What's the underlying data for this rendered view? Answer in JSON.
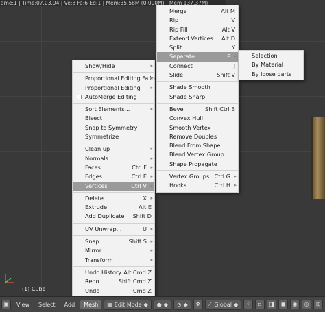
{
  "hud": {
    "top_text": "ame:1 | Time:07.03.94 | Ve:8 Fa:6 Ed:1 | Mem:35.58M (0.000M) | Mem 137.37M)"
  },
  "viewport": {
    "object_label": "(1) Cube"
  },
  "main_menu": {
    "items": [
      {
        "label": "Show/Hide",
        "shortcut": "",
        "submenu": true
      },
      {
        "sep": true
      },
      {
        "label": "Proportional Editing Falloff",
        "shortcut": "",
        "submenu": true
      },
      {
        "label": "Proportional Editing",
        "shortcut": "",
        "submenu": true
      },
      {
        "label": "AutoMerge Editing",
        "shortcut": "",
        "check": true
      },
      {
        "sep": true
      },
      {
        "label": "Sort Elements...",
        "shortcut": "",
        "submenu": true
      },
      {
        "label": "Bisect",
        "shortcut": ""
      },
      {
        "label": "Snap to Symmetry",
        "shortcut": ""
      },
      {
        "label": "Symmetrize",
        "shortcut": ""
      },
      {
        "sep": true
      },
      {
        "label": "Clean up",
        "shortcut": "",
        "submenu": true
      },
      {
        "label": "Normals",
        "shortcut": "",
        "submenu": true
      },
      {
        "label": "Faces",
        "shortcut": "Ctrl F",
        "submenu": true
      },
      {
        "label": "Edges",
        "shortcut": "Ctrl E",
        "submenu": true
      },
      {
        "label": "Vertices",
        "shortcut": "Ctrl V",
        "submenu": true,
        "highlight": true
      },
      {
        "sep": true
      },
      {
        "label": "Delete",
        "shortcut": "X",
        "submenu": true
      },
      {
        "label": "Extrude",
        "shortcut": "Alt E"
      },
      {
        "label": "Add Duplicate",
        "shortcut": "Shift D"
      },
      {
        "sep": true
      },
      {
        "label": "UV Unwrap...",
        "shortcut": "U",
        "submenu": true
      },
      {
        "sep": true
      },
      {
        "label": "Snap",
        "shortcut": "Shift S",
        "submenu": true
      },
      {
        "label": "Mirror",
        "shortcut": "",
        "submenu": true
      },
      {
        "label": "Transform",
        "shortcut": "",
        "submenu": true
      },
      {
        "sep": true
      },
      {
        "label": "Undo History",
        "shortcut": "Alt Cmd Z"
      },
      {
        "label": "Redo",
        "shortcut": "Shift Cmd Z"
      },
      {
        "label": "Undo",
        "shortcut": "Cmd Z"
      }
    ]
  },
  "vertices_menu": {
    "items": [
      {
        "label": "Merge",
        "shortcut": "Alt M"
      },
      {
        "label": "Rip",
        "shortcut": "V"
      },
      {
        "label": "Rip Fill",
        "shortcut": "Alt V"
      },
      {
        "label": "Extend Vertices",
        "shortcut": "Alt D"
      },
      {
        "label": "Split",
        "shortcut": "Y"
      },
      {
        "label": "Separate",
        "shortcut": "P",
        "submenu": true,
        "highlight": true
      },
      {
        "label": "Connect",
        "shortcut": "J"
      },
      {
        "label": "Slide",
        "shortcut": "Shift V"
      },
      {
        "sep": true
      },
      {
        "label": "Shade Smooth",
        "shortcut": ""
      },
      {
        "label": "Shade Sharp",
        "shortcut": ""
      },
      {
        "sep": true
      },
      {
        "label": "Bevel",
        "shortcut": "Shift Ctrl B"
      },
      {
        "label": "Convex Hull",
        "shortcut": ""
      },
      {
        "label": "Smooth Vertex",
        "shortcut": ""
      },
      {
        "label": "Remove Doubles",
        "shortcut": ""
      },
      {
        "label": "Blend From Shape",
        "shortcut": ""
      },
      {
        "label": "Blend Vertex Group",
        "shortcut": ""
      },
      {
        "label": "Shape Propagate",
        "shortcut": ""
      },
      {
        "sep": true
      },
      {
        "label": "Vertex Groups",
        "shortcut": "Ctrl G",
        "submenu": true
      },
      {
        "label": "Hooks",
        "shortcut": "Ctrl H",
        "submenu": true
      }
    ]
  },
  "separate_menu": {
    "items": [
      {
        "label": "Selection"
      },
      {
        "label": "By Material"
      },
      {
        "label": "By loose parts"
      }
    ]
  },
  "header": {
    "view": "View",
    "select": "Select",
    "add": "Add",
    "mesh": "Mesh",
    "mode": "Edit Mode",
    "orientation": "Global"
  }
}
